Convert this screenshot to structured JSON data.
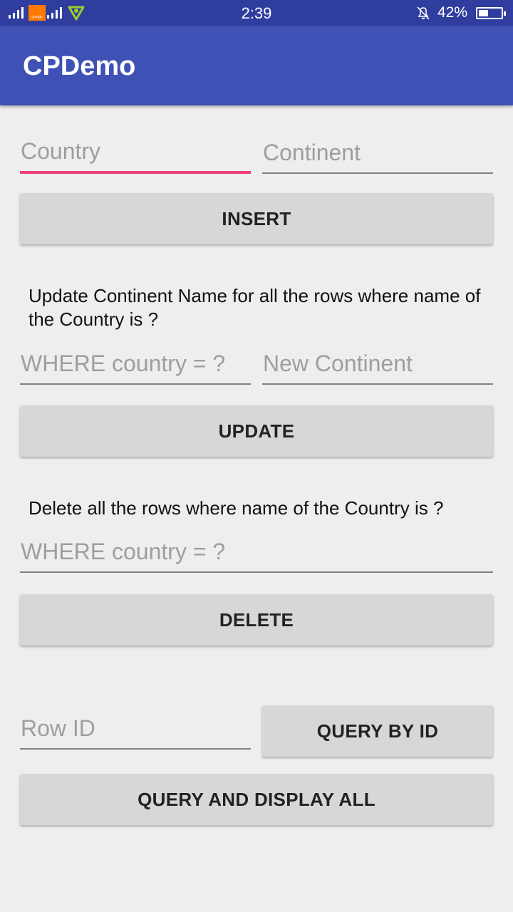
{
  "status_bar": {
    "carrier_logo_text": "orange",
    "time": "2:39",
    "battery_percent": "42%",
    "battery_level": 0.42,
    "icons": [
      "signal-icon",
      "orange-logo",
      "signal-icon",
      "etisalat-logo",
      "bell-off-icon",
      "battery-icon"
    ]
  },
  "app_bar": {
    "title": "CPDemo",
    "color": "#3f51b5"
  },
  "insert": {
    "country_placeholder": "Country",
    "continent_placeholder": "Continent",
    "button_label": "INSERT"
  },
  "update": {
    "description": "Update Continent Name for all the rows where name of the Country is ?",
    "where_placeholder": "WHERE country = ?",
    "new_continent_placeholder": "New Continent",
    "button_label": "UPDATE"
  },
  "delete": {
    "description": "Delete all the rows where name of the Country is ?",
    "where_placeholder": "WHERE country = ?",
    "button_label": "DELETE"
  },
  "query": {
    "row_id_placeholder": "Row ID",
    "query_by_id_label": "QUERY BY ID",
    "query_all_label": "QUERY AND DISPLAY ALL"
  },
  "colors": {
    "status_bar": "#2f3e9e",
    "accent": "#ec407a",
    "button": "#d6d7d7",
    "background": "#eeeeee"
  }
}
